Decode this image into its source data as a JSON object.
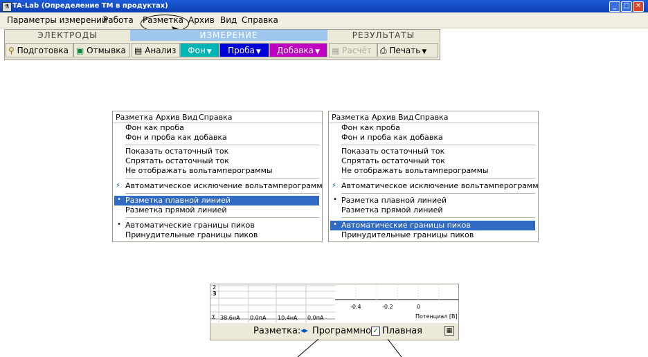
{
  "window": {
    "title": "TA-Lab (Определение ТМ в продуктах)",
    "icon": "app-icon",
    "controls": [
      "_",
      "□",
      "✕"
    ]
  },
  "menubar": {
    "items": [
      "Параметры измерений",
      "Работа",
      "Разметка",
      "Архив",
      "Вид",
      "Справка"
    ]
  },
  "toolbar": {
    "groups": {
      "electrodes": "ЭЛЕКТРОДЫ",
      "measurement": "ИЗМЕРЕНИЕ",
      "results": "РЕЗУЛЬТАТЫ"
    },
    "buttons": {
      "prepare": "Подготовка",
      "wash": "Отмывка",
      "analysis": "Анализ",
      "background": "Фон",
      "sample": "Проба",
      "addition": "Добавка",
      "calc": "Расчёт",
      "print": "Печать"
    },
    "colors": {
      "measurement_head": "#9fc6ee",
      "background": "#00b5b5",
      "sample": "#0000d8",
      "addition": "#c000c0"
    }
  },
  "menu_left": {
    "bar": [
      "Разметка",
      "Архив",
      "Вид",
      "Справка"
    ],
    "items": [
      "Фон как проба",
      "Фон и проба как добавка",
      "Показать остаточный ток",
      "Спрятать остаточный ток",
      "Не отображать вольтамперограммы",
      "Автоматическое исключение вольтамперограмм",
      "Разметка плавной линией",
      "Разметка прямой линией",
      "Автоматические границы пиков",
      "Принудительные границы пиков"
    ],
    "highlighted": "Разметка плавной линией"
  },
  "menu_right": {
    "bar": [
      "Разметка",
      "Архив",
      "Вид",
      "Справка"
    ],
    "items": [
      "Фон как проба",
      "Фон и проба как добавка",
      "Показать остаточный ток",
      "Спрятать остаточный ток",
      "Не отображать вольтамперограммы",
      "Автоматическое исключение вольтамперограмм",
      "Разметка плавной линией",
      "Разметка прямой линией",
      "Автоматические границы пиков",
      "Принудительные границы пиков"
    ],
    "highlighted": "Автоматические границы пиков"
  },
  "bottom_panel": {
    "row_labels": [
      "2",
      "3"
    ],
    "sigma": "Σ",
    "sums": [
      "38.6нА",
      "0.0пА",
      "10.4нА",
      "0.0пА"
    ],
    "axis_ticks": [
      "-0.4",
      "-0.2",
      "0"
    ],
    "axis_label": "Потенциал [В]",
    "status_label": "Разметка:",
    "mode_value": "Программно",
    "line_value": "Плавная"
  }
}
